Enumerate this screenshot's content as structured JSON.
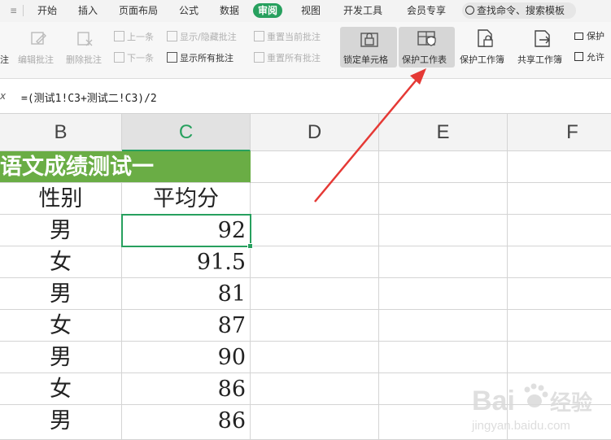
{
  "menu": {
    "tabs": [
      "开始",
      "插入",
      "页面布局",
      "公式",
      "数据",
      "审阅",
      "视图",
      "开发工具",
      "会员专享"
    ],
    "active_tab": "审阅",
    "search_placeholder": "查找命令、搜索模板"
  },
  "ribbon": {
    "left_partial": "注",
    "edit_comment": "编辑批注",
    "delete_comment": "删除批注",
    "prev": "上一条",
    "next": "下一条",
    "show_hide": "显示/隐藏批注",
    "show_all": "显示所有批注",
    "reset_current": "重置当前批注",
    "reset_all": "重置所有批注",
    "lock_cell": "锁定单元格",
    "protect_sheet": "保护工作表",
    "protect_book": "保护工作簿",
    "share_book": "共享工作簿",
    "protect_partial": "保护",
    "allow_partial": "允许"
  },
  "formula_bar": {
    "fx": "x",
    "formula": "=(测试1!C3+测试二!C3)/2"
  },
  "columns": [
    "B",
    "C",
    "D",
    "E",
    "F"
  ],
  "selected_column": "C",
  "sheet": {
    "title": "语文成绩测试一",
    "headers": [
      "性别",
      "平均分"
    ],
    "rows": [
      {
        "gender": "男",
        "avg": "92"
      },
      {
        "gender": "女",
        "avg": "91.5"
      },
      {
        "gender": "男",
        "avg": "81"
      },
      {
        "gender": "女",
        "avg": "87"
      },
      {
        "gender": "男",
        "avg": "90"
      },
      {
        "gender": "女",
        "avg": "86"
      },
      {
        "gender": "男",
        "avg": "86"
      }
    ]
  },
  "watermark": {
    "brand": "Bai",
    "brand2": "经验",
    "url": "jingyan.baidu.com"
  },
  "colors": {
    "accent": "#27a05e",
    "title_fill": "#6aad45",
    "arrow": "#e53935"
  }
}
